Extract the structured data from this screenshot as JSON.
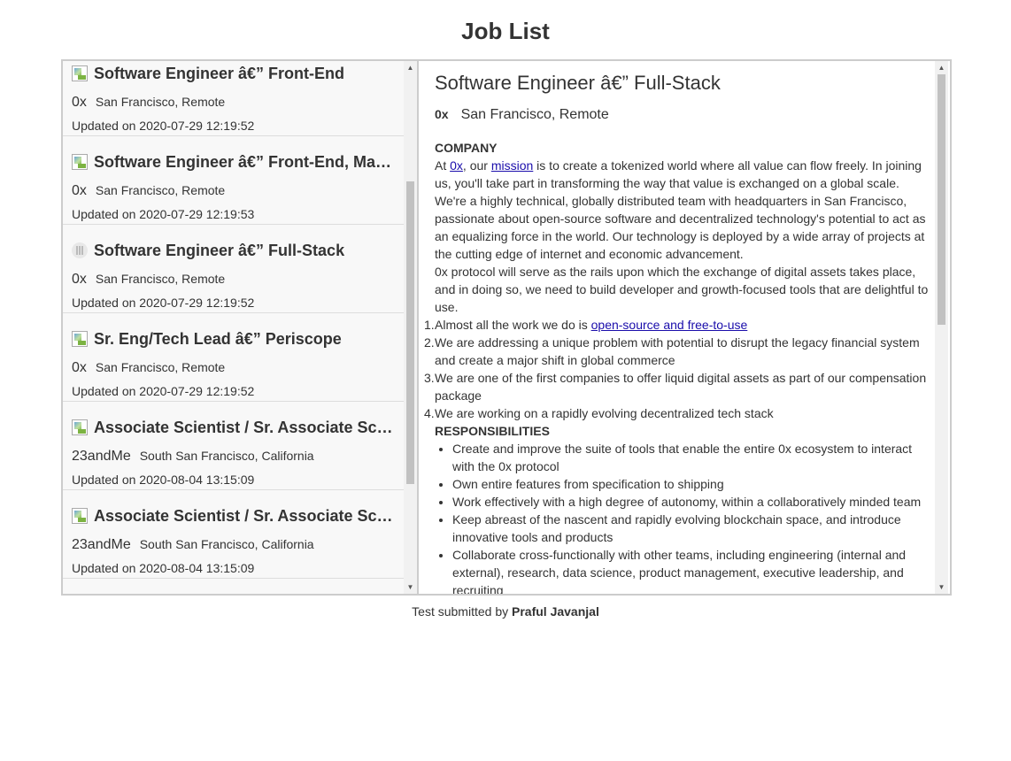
{
  "page": {
    "title": "Job List"
  },
  "jobs": [
    {
      "title": "Software Engineer â€” Front-End",
      "company": "0x",
      "location": "San Francisco, Remote",
      "updated": "Updated on 2020-07-29 12:19:52"
    },
    {
      "title": "Software Engineer â€” Front-End, Ma…",
      "company": "0x",
      "location": "San Francisco, Remote",
      "updated": "Updated on 2020-07-29 12:19:53"
    },
    {
      "title": "Software Engineer â€” Full-Stack",
      "company": "0x",
      "location": "San Francisco, Remote",
      "updated": "Updated on 2020-07-29 12:19:52"
    },
    {
      "title": "Sr. Eng/Tech Lead â€” Periscope",
      "company": "0x",
      "location": "San Francisco, Remote",
      "updated": "Updated on 2020-07-29 12:19:52"
    },
    {
      "title": "Associate Scientist / Sr. Associate Sc…",
      "company": "23andMe",
      "location": "South San Francisco, California",
      "updated": "Updated on 2020-08-04 13:15:09"
    },
    {
      "title": "Associate Scientist / Sr. Associate Sc…",
      "company": "23andMe",
      "location": "South San Francisco, California",
      "updated": "Updated on 2020-08-04 13:15:09"
    }
  ],
  "detail": {
    "title": "Software Engineer â€” Full-Stack",
    "company": "0x",
    "location": "San Francisco, Remote",
    "company_heading": "COMPANY",
    "p1_at": "At ",
    "p1_link1": "0x",
    "p1_mid": ", our ",
    "p1_link2": "mission",
    "p1_rest": " is to create a tokenized world where all value can flow freely. In joining us, you'll take part in transforming the way that value is exchanged on a global scale. We're a highly technical, globally distributed team with headquarters in San Francisco, passionate about open-source software and decentralized technology's potential to act as an equalizing force in the world.  Our technology is deployed by a wide array of projects at the cutting edge of internet and economic advancement.",
    "p2": "0x protocol will serve as the rails upon which the exchange of digital assets takes place, and in doing so, we need to build developer and growth-focused tools that are delightful to use.",
    "facts": [
      {
        "num": "1.",
        "pre": "Almost all the work we do is ",
        "link": "open-source and free-to-use",
        "text": ""
      },
      {
        "num": "2.",
        "pre": "",
        "link": "",
        "text": "We are addressing a unique problem with potential to disrupt the legacy financial system and create a major shift in global commerce"
      },
      {
        "num": "3.",
        "pre": "",
        "link": "",
        "text": "We are one of the first companies to offer liquid digital assets as part of our compensation package"
      },
      {
        "num": "4.",
        "pre": "",
        "link": "",
        "text": "We are working on a rapidly evolving decentralized tech stack"
      }
    ],
    "resp_heading": "RESPONSIBILITIES",
    "responsibilities": [
      "Create and improve the suite of tools that enable the entire 0x ecosystem to interact with the 0x protocol",
      "Own entire features from specification to shipping",
      "Work effectively with a high degree of autonomy, within a collaboratively minded team",
      "Keep abreast of the nascent and rapidly evolving blockchain space, and introduce innovative tools and products",
      "Collaborate cross-functionally with other teams, including engineering (internal and external), research, data science, product management, executive leadership, and recruiting"
    ]
  },
  "footer": {
    "prefix": "Test submitted by ",
    "author": "Praful Javanjal"
  }
}
